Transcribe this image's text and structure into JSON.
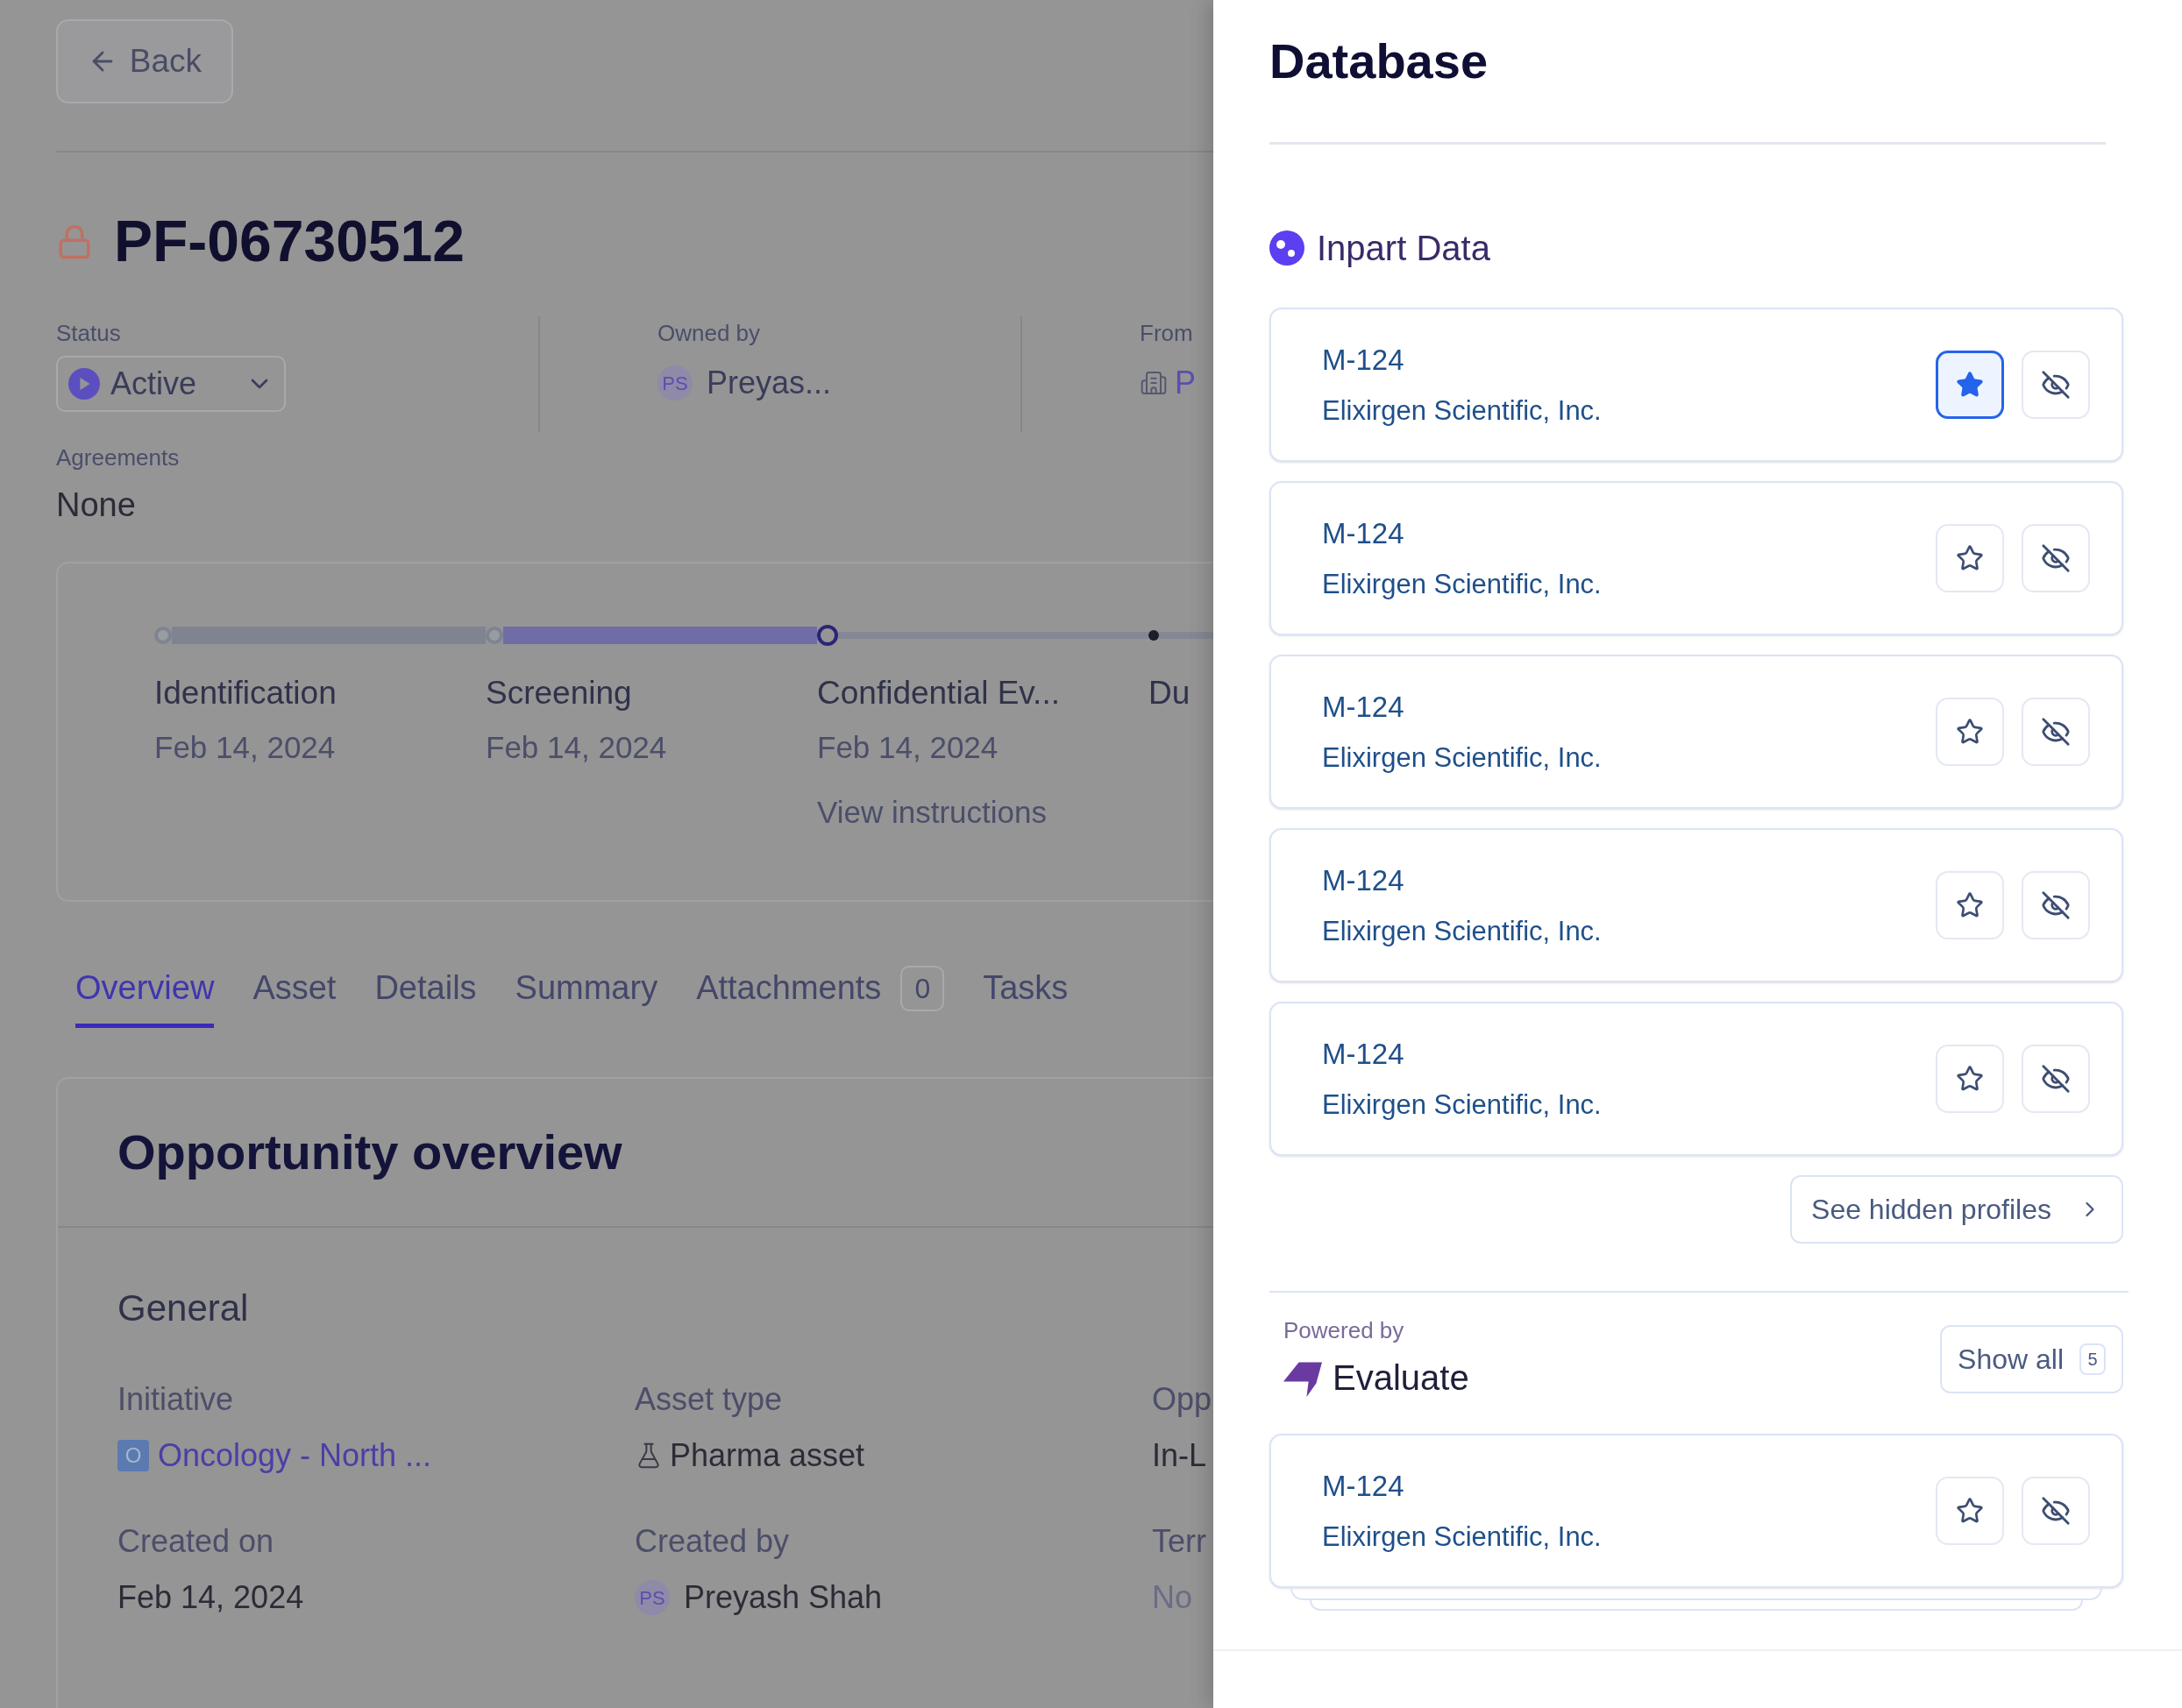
{
  "back_button": {
    "label": "Back"
  },
  "record": {
    "title": "PF-06730512"
  },
  "meta": {
    "status": {
      "label": "Status",
      "value": "Active"
    },
    "owned_by": {
      "label": "Owned by",
      "initials": "PS",
      "name": "Preyas..."
    },
    "from": {
      "label": "From",
      "value": "P"
    }
  },
  "agreements": {
    "label": "Agreements",
    "value": "None"
  },
  "stages": [
    {
      "name": "Identification",
      "date": "Feb 14, 2024",
      "kind": "done"
    },
    {
      "name": "Screening",
      "date": "Feb 14, 2024",
      "kind": "done"
    },
    {
      "name": "Confidential Ev...",
      "date": "Feb 14, 2024",
      "link": "View instructions",
      "kind": "current"
    },
    {
      "name": "Du",
      "kind": "upcoming"
    }
  ],
  "tabs": [
    {
      "label": "Overview",
      "selected": true
    },
    {
      "label": "Asset",
      "selected": false
    },
    {
      "label": "Details",
      "selected": false
    },
    {
      "label": "Summary",
      "selected": false
    },
    {
      "label": "Attachments",
      "count": "0",
      "selected": false
    },
    {
      "label": "Tasks",
      "selected": false
    }
  ],
  "overview": {
    "title": "Opportunity overview",
    "section": "General",
    "fields": [
      {
        "label": "Initiative",
        "value": "Oncology - North ...",
        "kind": "initiative",
        "badge": "O"
      },
      {
        "label": "Asset type",
        "value": "Pharma asset",
        "kind": "asset"
      },
      {
        "label": "Opp",
        "value": "In-L",
        "kind": "text"
      },
      {
        "label": "Created on",
        "value": "Feb 14, 2024",
        "kind": "text"
      },
      {
        "label": "Created by",
        "value": "Preyash Shah",
        "kind": "person",
        "initials": "PS"
      },
      {
        "label": "Terr",
        "value": "No",
        "kind": "muted"
      }
    ]
  },
  "drawer": {
    "title": "Database",
    "inpart": {
      "title": "Inpart Data",
      "profiles": [
        {
          "code": "M-124",
          "company": "Elixirgen Scientific, Inc.",
          "starred": true
        },
        {
          "code": "M-124",
          "company": "Elixirgen Scientific, Inc.",
          "starred": false
        },
        {
          "code": "M-124",
          "company": "Elixirgen Scientific, Inc.",
          "starred": false
        },
        {
          "code": "M-124",
          "company": "Elixirgen Scientific, Inc.",
          "starred": false
        },
        {
          "code": "M-124",
          "company": "Elixirgen Scientific, Inc.",
          "starred": false
        }
      ],
      "hidden_button": "See hidden profiles"
    },
    "evaluate": {
      "powered_by": "Powered by",
      "brand": "Evaluate",
      "show_all": "Show all",
      "count": "5",
      "profiles": [
        {
          "code": "M-124",
          "company": "Elixirgen Scientific, Inc.",
          "starred": false
        }
      ]
    }
  }
}
